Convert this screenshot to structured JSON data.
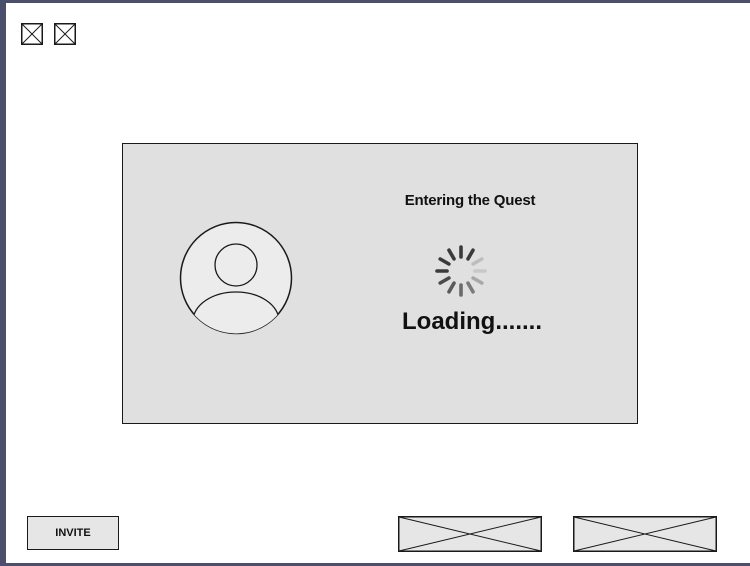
{
  "top_left_placeholders": [
    {
      "icon": "image-placeholder-icon"
    },
    {
      "icon": "image-placeholder-icon"
    }
  ],
  "loading_dialog": {
    "title": "Entering the Quest",
    "status_text": "Loading.......",
    "avatar_icon": "user-avatar-icon",
    "spinner_icon": "loading-spinner-icon"
  },
  "bottom_bar": {
    "invite_label": "INVITE",
    "placeholder_buttons": [
      {
        "icon": "image-placeholder-icon"
      },
      {
        "icon": "image-placeholder-icon"
      }
    ]
  },
  "colors": {
    "frame": "#4c4f6b",
    "dialog_background": "#e0e0e0",
    "button_background": "#e6e6e6",
    "outline": "#1a1a1a"
  }
}
